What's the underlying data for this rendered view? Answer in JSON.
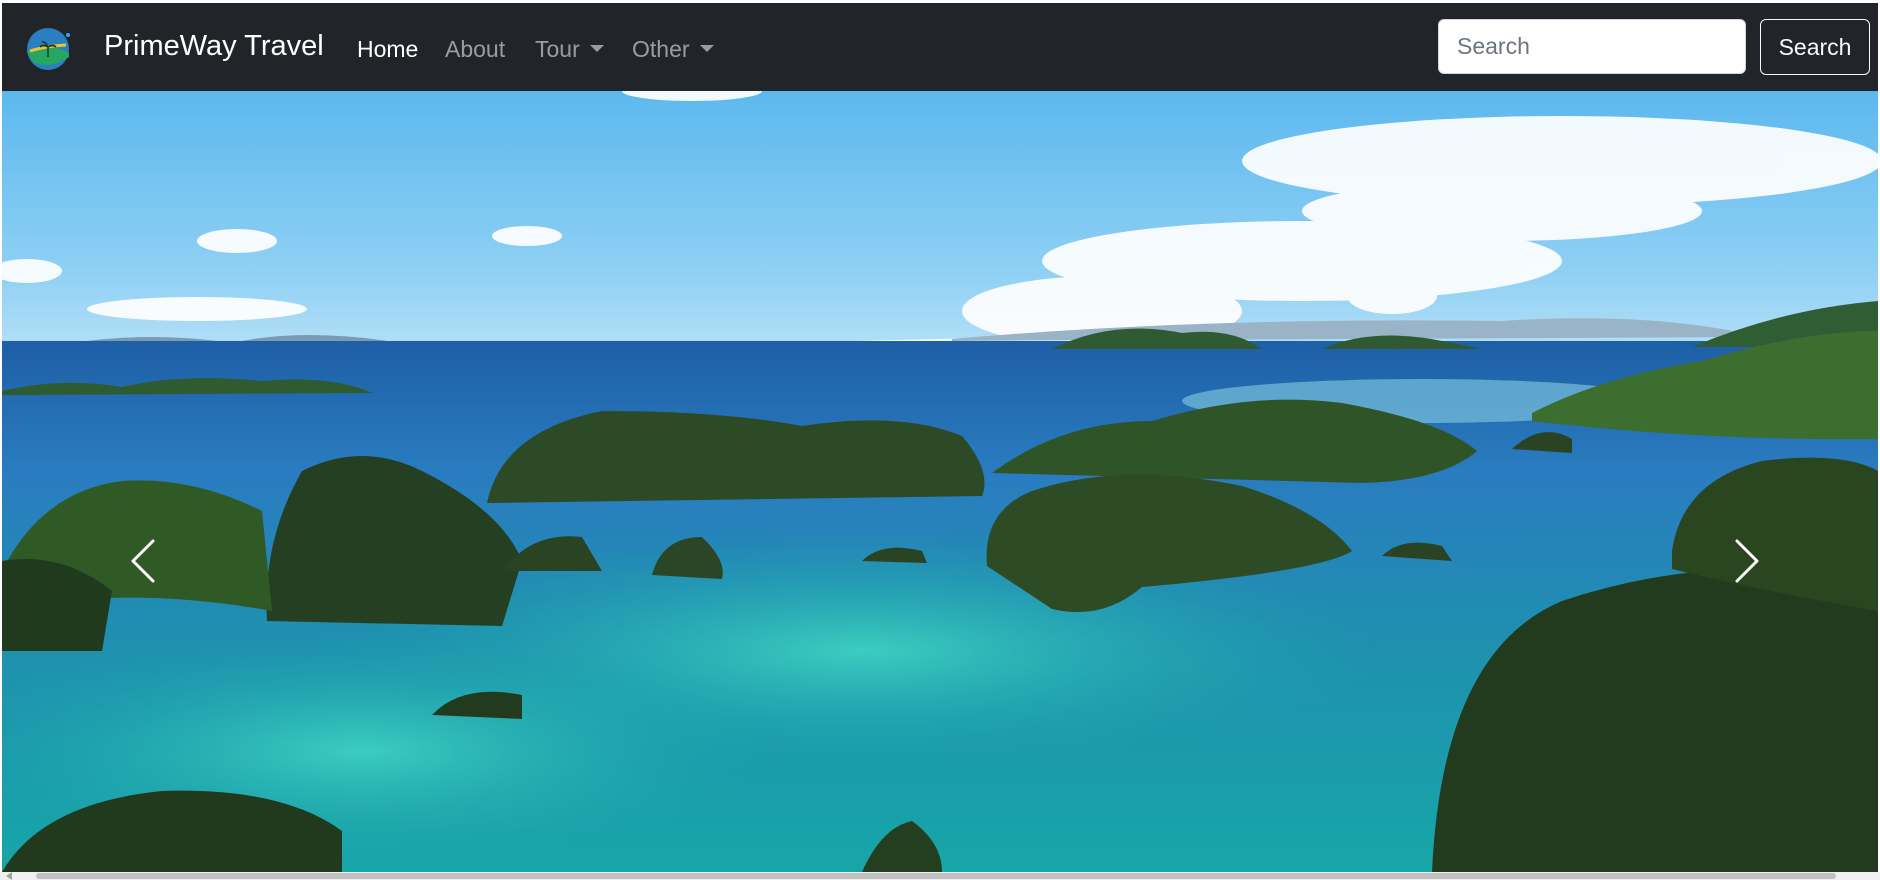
{
  "navbar": {
    "brand": "PrimeWay Travel",
    "logo_icon": "globe-palm-logo-icon",
    "links": [
      {
        "label": "Home",
        "active": true,
        "dropdown": false
      },
      {
        "label": "About",
        "active": false,
        "dropdown": false
      },
      {
        "label": "Tour",
        "active": false,
        "dropdown": true
      },
      {
        "label": "Other",
        "active": false,
        "dropdown": true
      }
    ],
    "search": {
      "placeholder": "Search",
      "value": ""
    },
    "search_button_label": "Search"
  },
  "carousel": {
    "image_subject": "tropical islands seascape",
    "prev_icon": "chevron-left-icon",
    "next_icon": "chevron-right-icon"
  },
  "colors": {
    "navbar_bg": "#212529",
    "nav_active": "#ffffff",
    "nav_inactive": "rgba(255,255,255,0.55)"
  }
}
